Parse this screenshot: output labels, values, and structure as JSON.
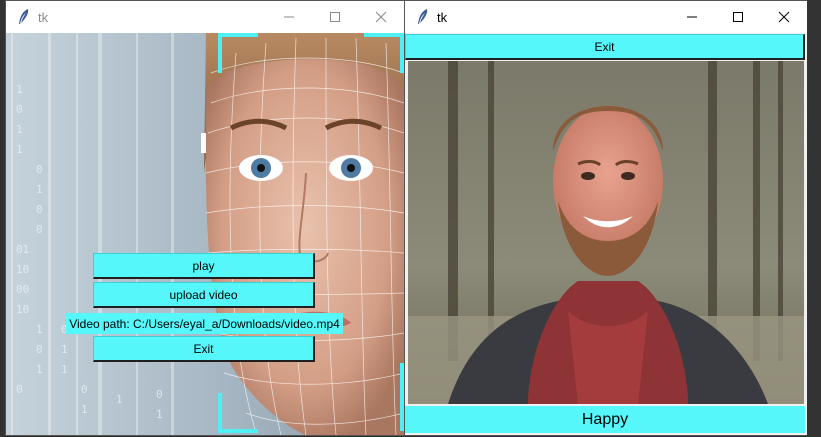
{
  "left_window": {
    "title": "tk",
    "buttons": {
      "play": "play",
      "upload": "upload video",
      "exit": "Exit"
    },
    "video_path_label": "Video path: C:/Users/eyal_a/Downloads/video.mp4",
    "image_description": "face scan with wireframe mesh overlay on binary code background"
  },
  "right_window": {
    "title": "tk",
    "exit_label": "Exit",
    "emotion_label": "Happy",
    "image_description": "smiling bearded man in red hoodie and dark coat outdoors"
  },
  "colors": {
    "accent": "#55f7fb",
    "titlebar": "#ffffff",
    "window_bg": "#f0f0f0"
  },
  "icons": [
    "feather-icon",
    "minimize-icon",
    "maximize-icon",
    "close-icon"
  ]
}
